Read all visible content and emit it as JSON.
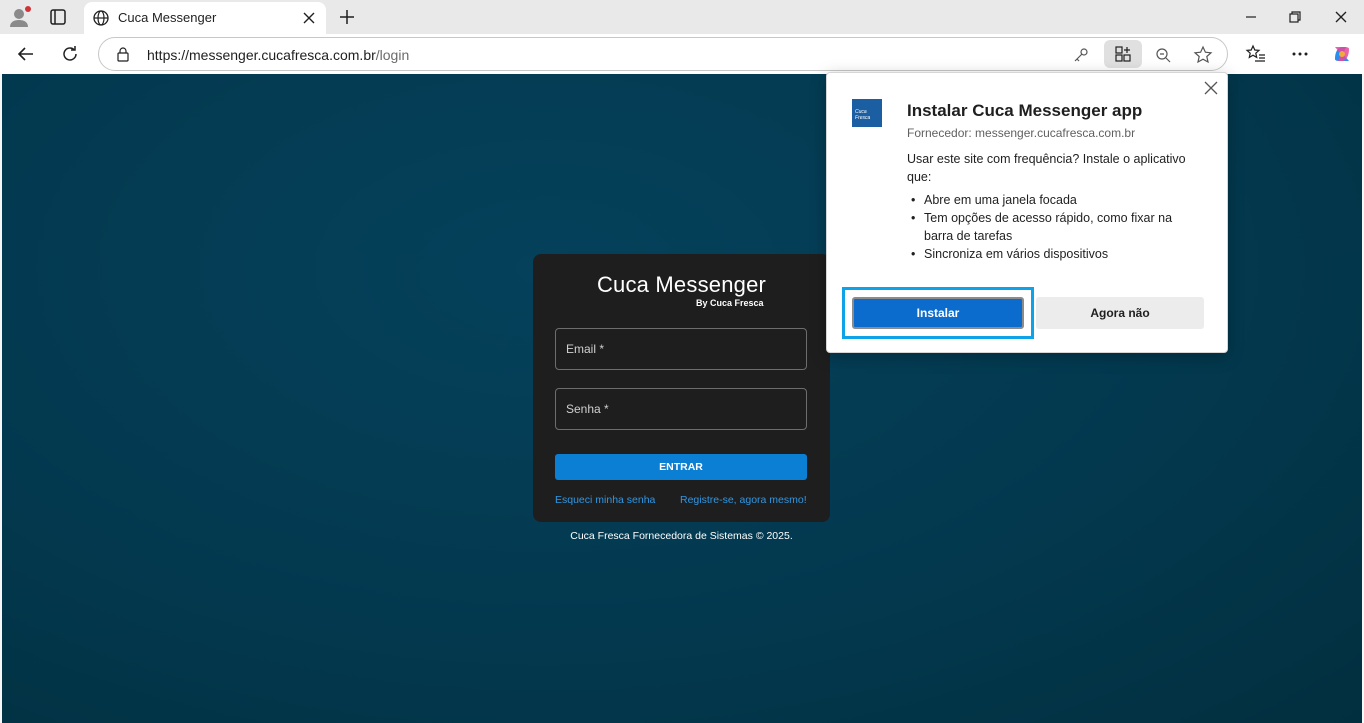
{
  "browser": {
    "tab": {
      "title": "Cuca Messenger"
    },
    "address_bar": {
      "url_host": "https://messenger.cucafresca.com.br",
      "url_path": "/login"
    },
    "colors": {
      "accent": "#0c6ccd",
      "focus_ring": "#0ea3e8"
    }
  },
  "login": {
    "brand_title": "Cuca Messenger",
    "brand_subtitle": "By Cuca Fresca",
    "email_label": "Email *",
    "password_label": "Senha *",
    "submit_label": "ENTRAR",
    "forgot_link": "Esqueci minha senha",
    "register_link": "Registre-se, agora mesmo!",
    "footer": "Cuca Fresca Fornecedora de Sistemas © 2025."
  },
  "install_popup": {
    "title": "Instalar Cuca Messenger app",
    "publisher": "Fornecedor: messenger.cucafresca.com.br",
    "description": "Usar este site com frequência? Instale o aplicativo que:",
    "features": [
      "Abre em uma janela focada",
      "Tem opções de acesso rápido, como fixar na barra de tarefas",
      "Sincroniza em vários dispositivos"
    ],
    "install_label": "Instalar",
    "not_now_label": "Agora não",
    "logo_text": "Cuca Fresca"
  }
}
